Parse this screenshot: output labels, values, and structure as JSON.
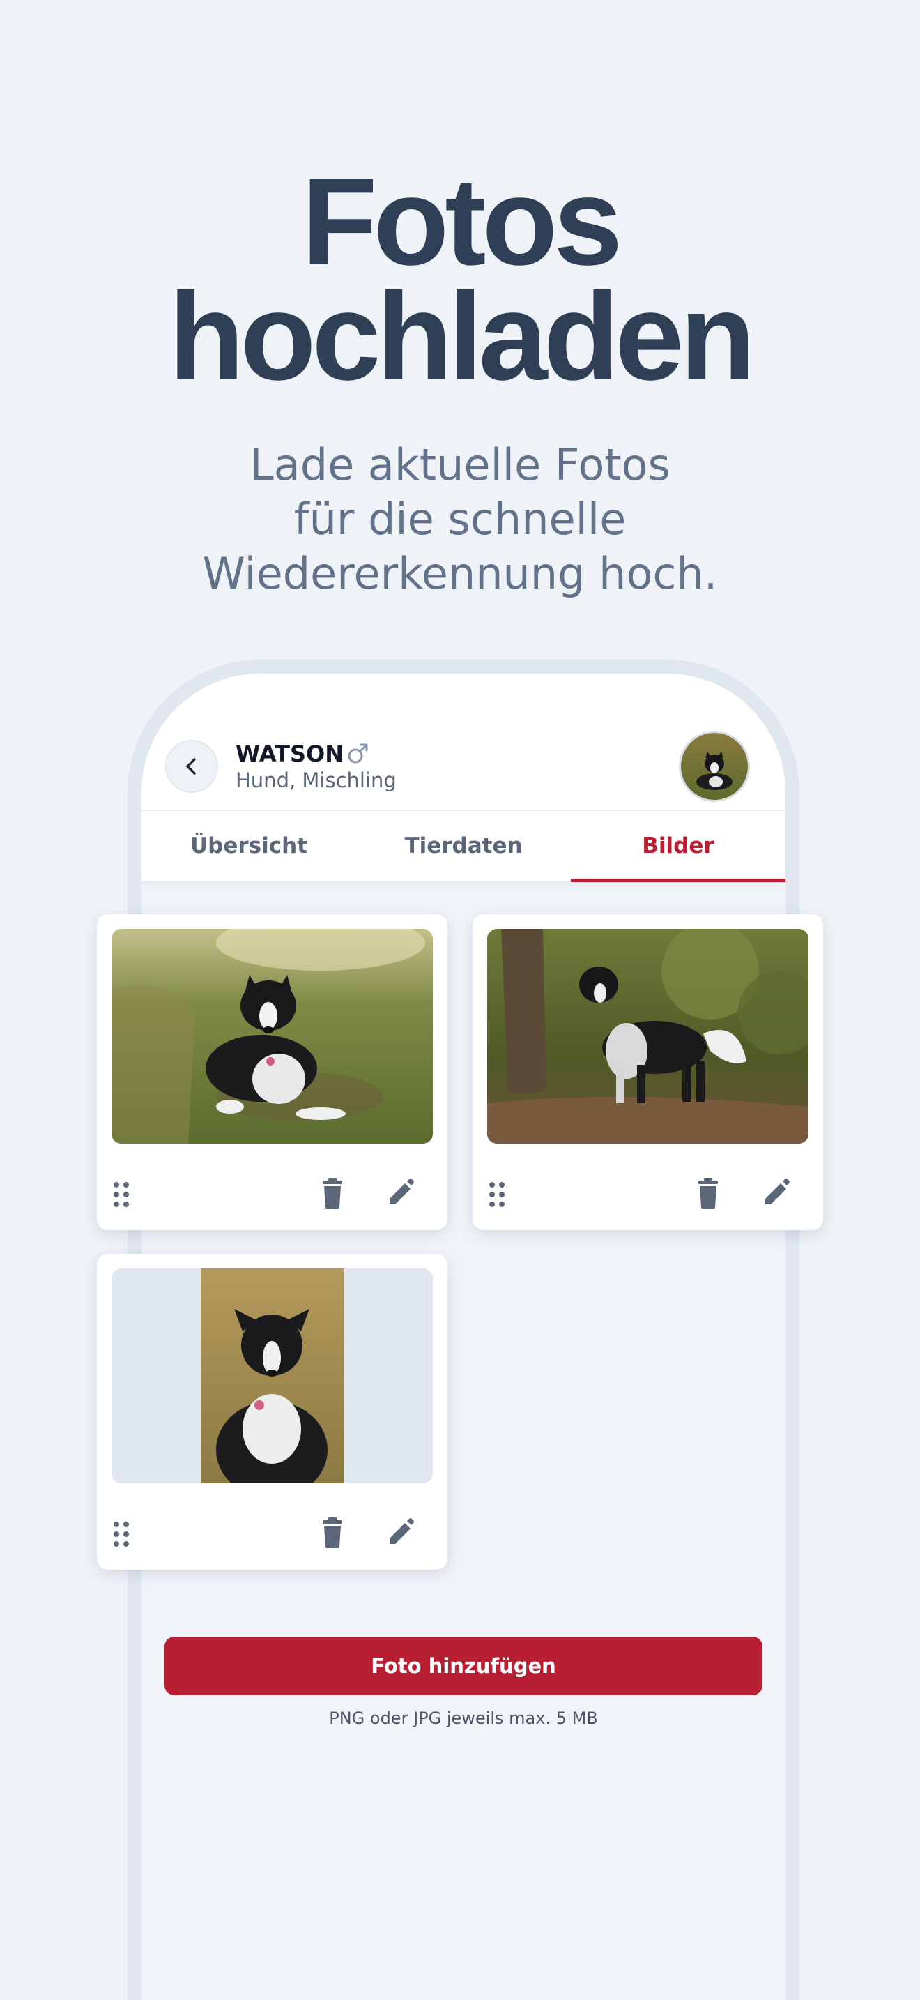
{
  "promo": {
    "headline_line1": "Fotos",
    "headline_line2": "hochladen",
    "subline": [
      "Lade aktuelle Fotos",
      "für die schnelle",
      "Wiedererkennung hoch."
    ]
  },
  "header": {
    "back_icon": "chevron-left-icon",
    "pet_name": "WATSON",
    "gender_symbol": "♂",
    "gender_icon": "male-icon",
    "pet_breed": "Hund, Mischling"
  },
  "tabs": [
    {
      "label": "Übersicht",
      "active": false
    },
    {
      "label": "Tierdaten",
      "active": false
    },
    {
      "label": "Bilder",
      "active": true
    }
  ],
  "photos": [
    {
      "subject": "dog lying in grass",
      "actions": [
        "drag-handle-icon",
        "trash-icon",
        "pencil-icon"
      ]
    },
    {
      "subject": "dog standing by tree",
      "actions": [
        "drag-handle-icon",
        "trash-icon",
        "pencil-icon"
      ]
    },
    {
      "subject": "dog portrait",
      "actions": [
        "drag-handle-icon",
        "trash-icon",
        "pencil-icon"
      ]
    }
  ],
  "add_button": {
    "label": "Foto hinzufügen"
  },
  "upload_hint": "PNG oder JPG jeweils max. 5 MB",
  "colors": {
    "background": "#eff3f8",
    "headline": "#2f3f56",
    "subline": "#62728a",
    "accent": "#b81f33",
    "icon": "#5b6779"
  }
}
